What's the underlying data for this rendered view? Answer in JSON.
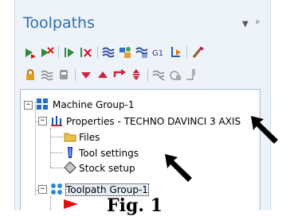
{
  "panel": {
    "title": "Toolpaths",
    "dropdown_icon": "chevron-down-icon",
    "pin_icon": "pin-icon"
  },
  "toolbar_row1": [
    "select-all-ops-icon",
    "select-all-dirty-icon",
    "regenerate-selected-icon",
    "regenerate-dirty-icon",
    "backplot-icon",
    "verify-icon",
    "simulate-icon",
    "g1-post-icon",
    "post-selected-icon",
    "highfeed-icon"
  ],
  "toolbar_row2": [
    "lock-icon",
    "toggle-display-icon",
    "toggle-posting-icon",
    "move-down-icon",
    "move-up-icon",
    "insert-arrow-icon",
    "scroll-icon",
    "stock-display-icon",
    "stock-shading-icon"
  ],
  "tree": {
    "machine_group": "Machine Group-1",
    "properties": "Properties - TECHNO DAVINCI 3 AXIS",
    "files": "Files",
    "tool_settings": "Tool settings",
    "stock_setup": "Stock setup",
    "toolpath_group": "Toolpath Group-1"
  },
  "figure_caption": "Fig. 1",
  "colors": {
    "title": "#2e6db5",
    "pane_bg": "#eef3fa",
    "tree_border": "#aab8cc"
  }
}
